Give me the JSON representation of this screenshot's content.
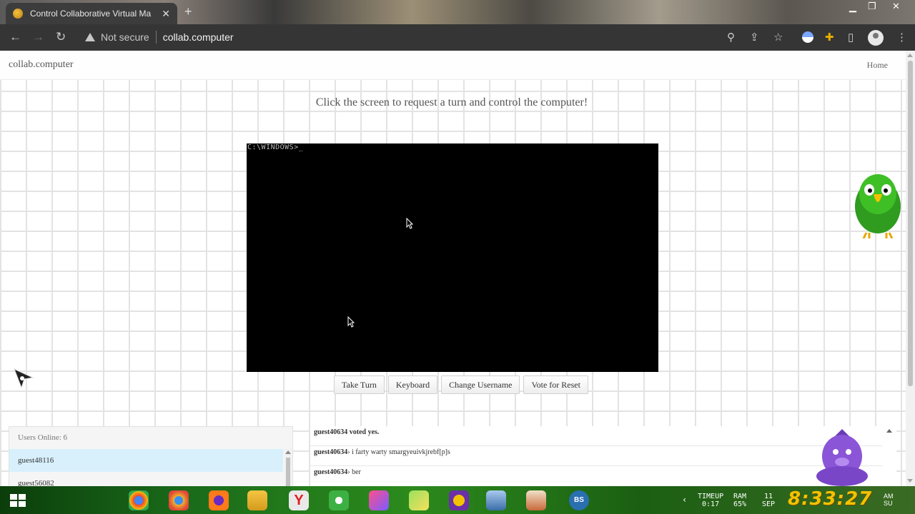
{
  "browser": {
    "tab_title": "Control Collaborative Virtual Ma",
    "tab_close": "✕",
    "new_tab": "+",
    "security_label": "Not secure",
    "url": "collab.computer"
  },
  "site": {
    "brand": "collab.computer",
    "nav_home": "Home",
    "instruction": "Click the screen to request a turn and control the computer!",
    "vm_prompt": "C:\\WINDOWS>_",
    "buttons": {
      "take_turn": "Take Turn",
      "keyboard": "Keyboard",
      "change_username": "Change Username",
      "vote_reset": "Vote for Reset"
    },
    "users": {
      "header": "Users Online: 6",
      "list": [
        "guest48116",
        "guest56082"
      ]
    },
    "chat": [
      {
        "user": "guest40634",
        "text": "voted yes.",
        "separator": " "
      },
      {
        "user": "guest40634",
        "text": "i farty warty smargyeuivkjrebf[p]s",
        "separator": "› "
      },
      {
        "user": "guest40634",
        "text": "ber",
        "separator": "› "
      }
    ]
  },
  "taskbar": {
    "timeup_label": "TIMEUP",
    "timeup_value": "0:17",
    "ram_label": "RAM",
    "ram_value": "65%",
    "date_day": "11",
    "date_month": "SEP",
    "clock": "8:33:27",
    "ampm": "AM",
    "weekday": "SU"
  },
  "colors": {
    "vm_screen": "#000000",
    "highlight_row": "#d8f0fb",
    "clock": "#f2c200",
    "taskbar": "#1a6a1a"
  }
}
